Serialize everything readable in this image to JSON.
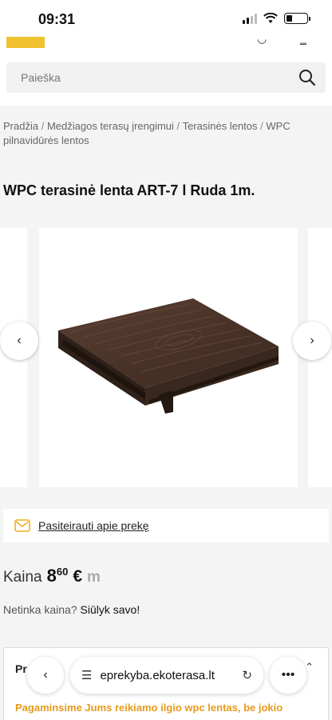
{
  "status_bar": {
    "time": "09:31"
  },
  "search": {
    "placeholder": "Paieška"
  },
  "breadcrumb": {
    "items": [
      "Pradžia",
      "Medžiagos terasų įrengimui",
      "Terasinės lentos",
      "WPC pilnavidūrės lentos"
    ],
    "separator": "/"
  },
  "product": {
    "title": "WPC terasinė lenta ART-7 l Ruda 1m.",
    "inquiry_label": "Pasiteirauti apie prekę",
    "price": {
      "label": "Kaina",
      "whole": "8",
      "cents": "60",
      "currency": "€",
      "unit": "m"
    },
    "offer": {
      "question": "Netinka kaina?",
      "link": "Siūlyk savo!"
    },
    "info_card": {
      "heading": "Pr",
      "body": "Pagaminsime Jums reikiamo ilgio wpc lentas, be jokio"
    }
  },
  "browser": {
    "url": "eprekyba.ekoterasa.lt"
  },
  "colors": {
    "accent": "#f0c230",
    "highlight_text": "#e89a1c",
    "board_brown": "#4a3328"
  }
}
